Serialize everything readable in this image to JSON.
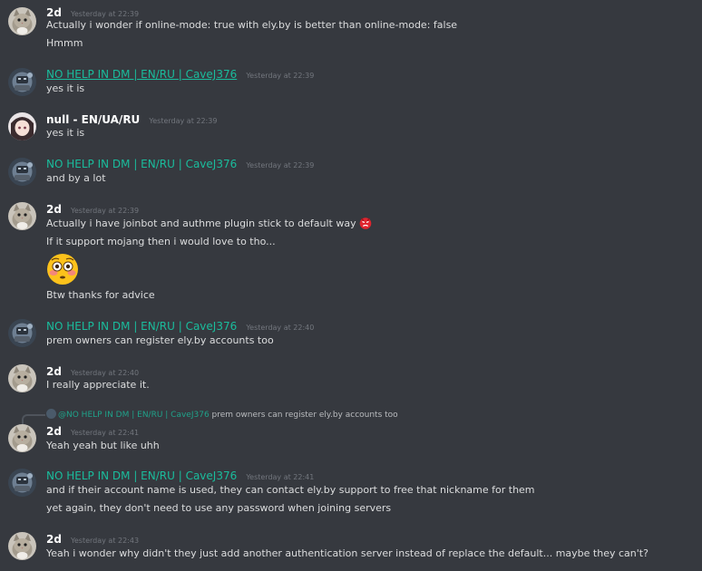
{
  "messages": [
    {
      "author": "2d",
      "timestamp": "Yesterday at 22:39",
      "lines": [
        "Actually i wonder if online-mode: true with ely.by is better than online-mode: false",
        "Hmmm"
      ]
    },
    {
      "author": "NO HELP IN DM | EN/RU | CaveJ376",
      "timestamp": "Yesterday at 22:39",
      "lines": [
        "yes it is"
      ]
    },
    {
      "author": "null - EN/UA/RU",
      "timestamp": "Yesterday at 22:39",
      "lines": [
        "yes it is"
      ]
    },
    {
      "author": "NO HELP IN DM | EN/RU | CaveJ376",
      "timestamp": "Yesterday at 22:39",
      "lines": [
        "and by a lot"
      ]
    },
    {
      "author": "2d",
      "timestamp": "Yesterday at 22:39",
      "lines": [
        "Actually i have joinbot and authme plugin stick to default way",
        "If it support mojang then i would love to tho...",
        "Btw thanks for advice"
      ],
      "inline_emoji": "angry-face-emoji",
      "big_emoji": "flushed-face-emoji"
    },
    {
      "author": "NO HELP IN DM | EN/RU | CaveJ376",
      "timestamp": "Yesterday at 22:40",
      "lines": [
        "prem owners can register ely.by accounts too"
      ]
    },
    {
      "author": "2d",
      "timestamp": "Yesterday at 22:40",
      "lines": [
        "I really appreciate it."
      ]
    },
    {
      "author": "2d",
      "timestamp": "Yesterday at 22:41",
      "reply": {
        "author": "@NO HELP IN DM | EN/RU | CaveJ376",
        "text": "prem owners can register ely.by accounts too"
      },
      "lines": [
        "Yeah yeah but like uhh"
      ]
    },
    {
      "author": "NO HELP IN DM | EN/RU | CaveJ376",
      "timestamp": "Yesterday at 22:41",
      "lines": [
        "and if their account name is used, they can contact ely.by support to free that nickname for them",
        "yet again, they don't need to use any password when joining servers"
      ]
    },
    {
      "author": "2d",
      "timestamp": "Yesterday at 22:43",
      "lines": [
        "Yeah i wonder why didn't they just add another authentication server instead of replace the default... maybe they can't?"
      ]
    }
  ],
  "colors": {
    "background": "#36393f",
    "message_text": "#dcddde",
    "timestamp": "#72767d",
    "teal_role": "#1abc9c",
    "username_white": "#ffffff"
  }
}
